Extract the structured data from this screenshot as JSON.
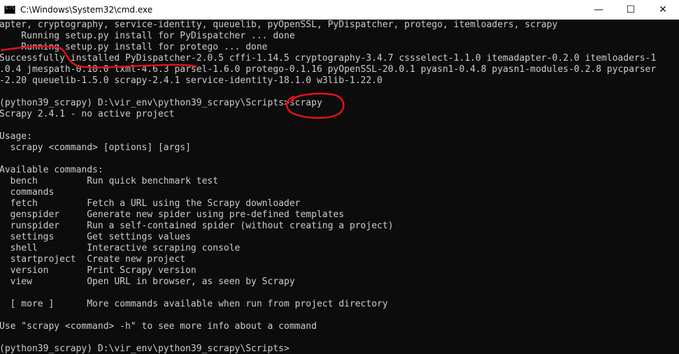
{
  "window": {
    "title": "C:\\Windows\\System32\\cmd.exe",
    "minimize_glyph": "—",
    "maximize_glyph": "☐",
    "close_glyph": "✕"
  },
  "terminal": {
    "lines": [
      "apter, cryptography, service-identity, queuelib, pyOpenSSL, PyDispatcher, protego, itemloaders, scrapy",
      "    Running setup.py install for PyDispatcher ... done",
      "    Running setup.py install for protego ... done",
      "Successfully installed PyDispatcher-2.0.5 cffi-1.14.5 cryptography-3.4.7 cssselect-1.1.0 itemadapter-0.2.0 itemloaders-1",
      ".0.4 jmespath-0.10.0 lxml-4.6.3 parsel-1.6.0 protego-0.1.16 pyOpenSSL-20.0.1 pyasn1-0.4.8 pyasn1-modules-0.2.8 pycparser",
      "-2.20 queuelib-1.5.0 scrapy-2.4.1 service-identity-18.1.0 w3lib-1.22.0",
      "",
      "(python39_scrapy) D:\\vir_env\\python39_scrapy\\Scripts>scrapy",
      "Scrapy 2.4.1 - no active project",
      "",
      "Usage:",
      "  scrapy <command> [options] [args]",
      "",
      "Available commands:",
      "  bench         Run quick benchmark test",
      "  commands",
      "  fetch         Fetch a URL using the Scrapy downloader",
      "  genspider     Generate new spider using pre-defined templates",
      "  runspider     Run a self-contained spider (without creating a project)",
      "  settings      Get settings values",
      "  shell         Interactive scraping console",
      "  startproject  Create new project",
      "  version       Print Scrapy version",
      "  view          Open URL in browser, as seen by Scrapy",
      "",
      "  [ more ]      More commands available when run from project directory",
      "",
      "Use \"scrapy <command> -h\" to see more info about a command",
      "",
      "(python39_scrapy) D:\\vir_env\\python39_scrapy\\Scripts>"
    ]
  },
  "colors": {
    "annotation": "#e0121d",
    "terminal_text": "#cccccc",
    "terminal_bg": "#0c0c0c"
  }
}
